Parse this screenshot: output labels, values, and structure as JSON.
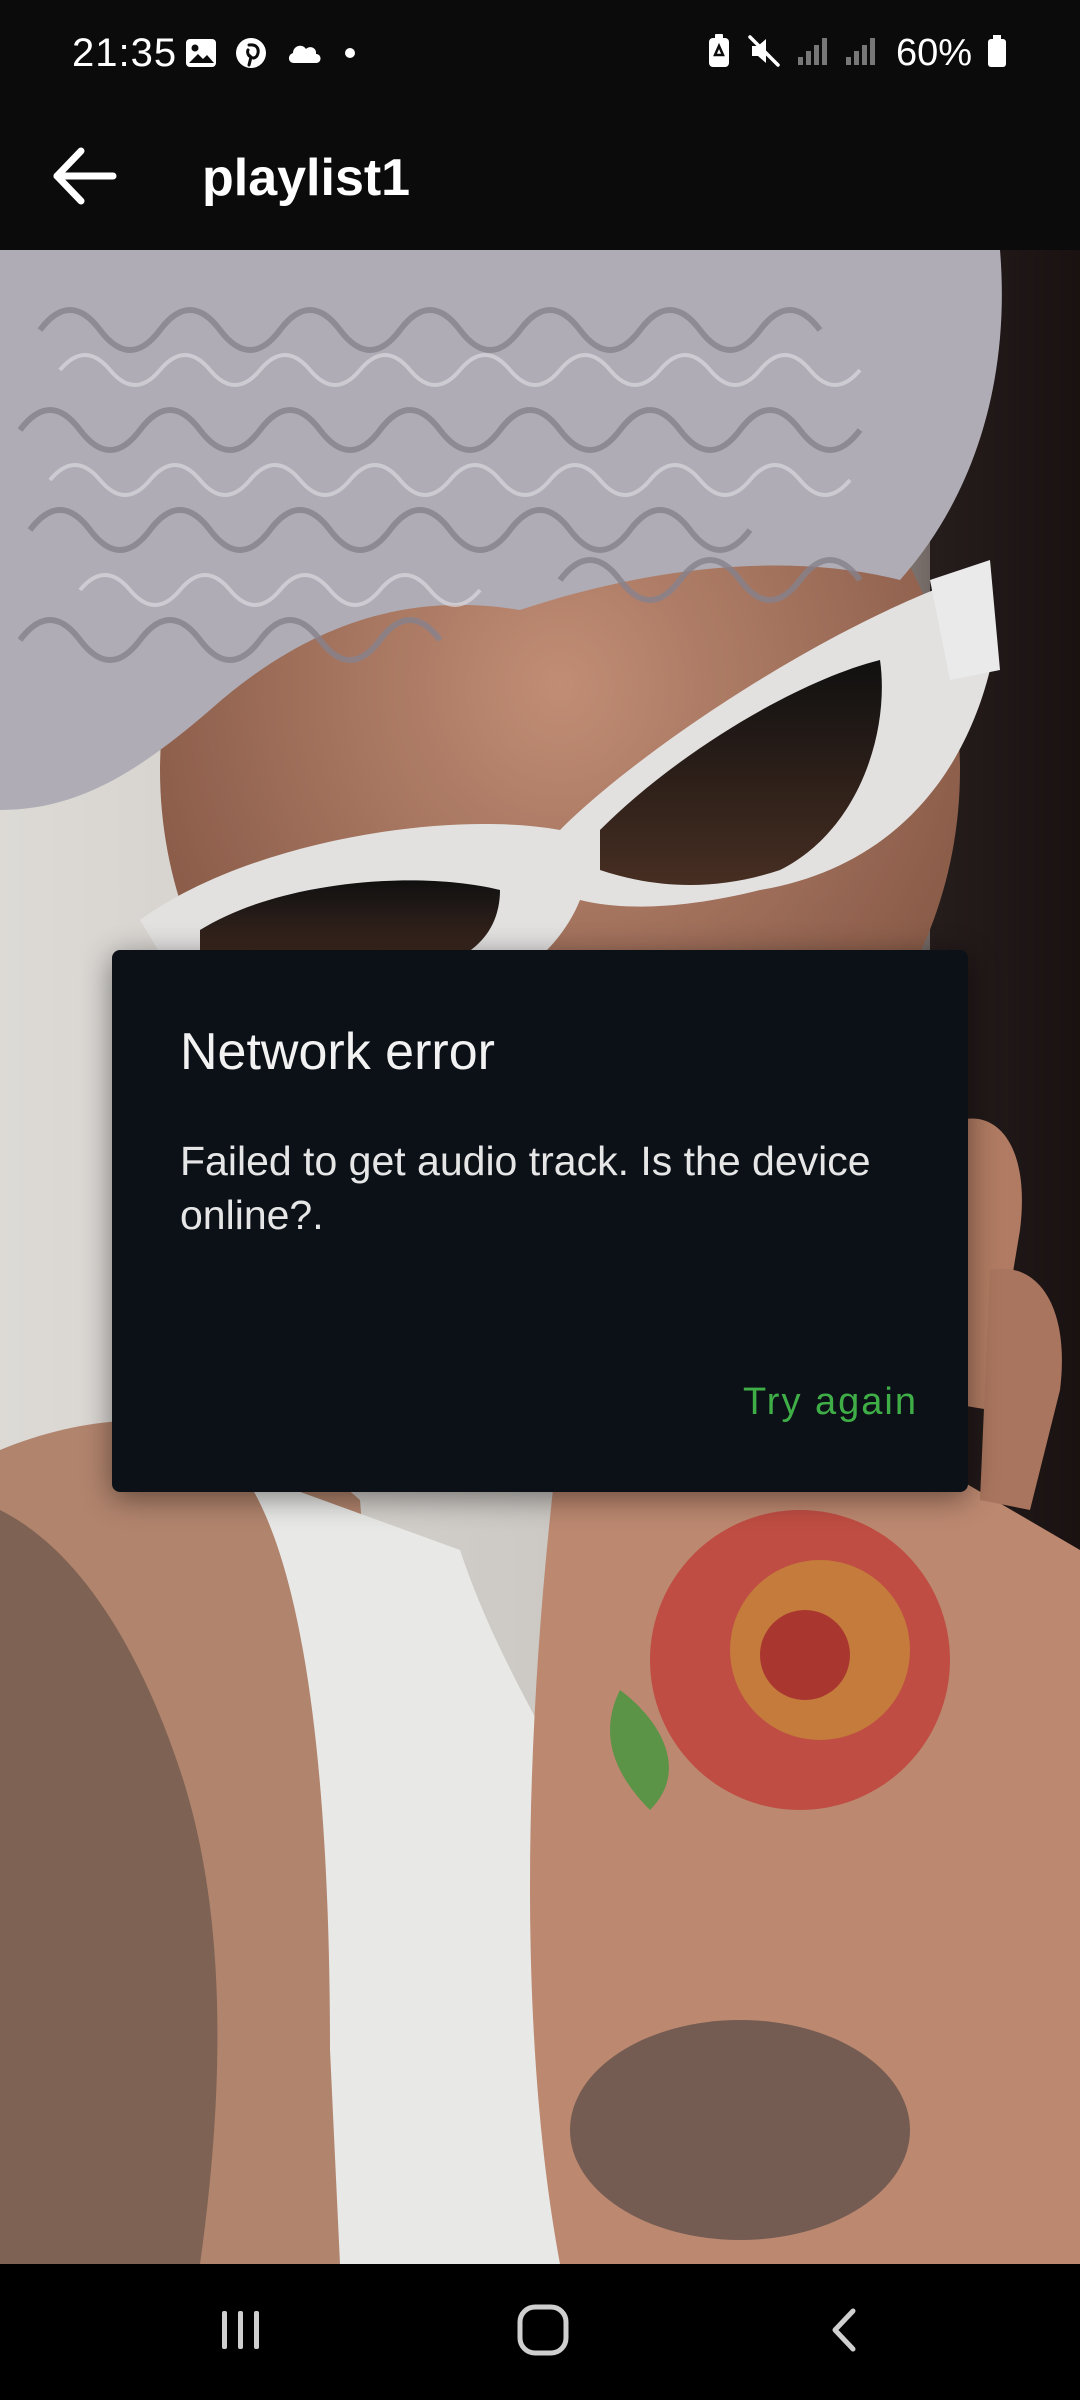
{
  "status_bar": {
    "time": "21:35",
    "battery": "60%",
    "left_icons": [
      "gallery-icon",
      "pinterest-icon",
      "cloud-icon",
      "dot-icon"
    ],
    "right_icons": [
      "battery-saver-icon",
      "mute-icon",
      "signal-icon",
      "signal-icon",
      "battery-icon"
    ]
  },
  "app_bar": {
    "title": "playlist1",
    "back_icon": "arrow-left-icon"
  },
  "dialog": {
    "title": "Network error",
    "message": "Failed to get audio track. Is the device online?.",
    "action_label": "Try again",
    "action_color": "#3fae47",
    "background_color": "#0c1118"
  },
  "nav_bar": {
    "icons": [
      "recent-apps-icon",
      "home-icon",
      "back-icon"
    ]
  }
}
